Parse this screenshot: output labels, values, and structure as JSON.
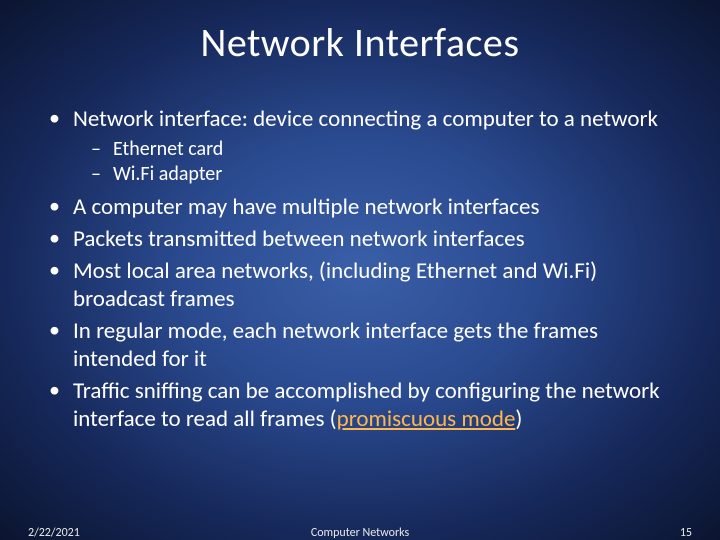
{
  "slide": {
    "title": "Network Interfaces",
    "bullets": {
      "b0": "Network interface: device connecting a computer to a network",
      "b0_sub0": "Ethernet card",
      "b0_sub1": "Wi.Fi adapter",
      "b1": "A computer may have multiple network interfaces",
      "b2": "Packets transmitted between network interfaces",
      "b3": "Most local area networks, (including Ethernet and Wi.Fi) broadcast frames",
      "b4": "In regular mode, each network interface gets the frames intended for it",
      "b5_pre": "Traffic sniffing can be accomplished by configuring the network interface to read all frames (",
      "b5_link": "promiscuous mode",
      "b5_post": ")"
    },
    "footer": {
      "date": "2/22/2021",
      "title": "Computer Networks",
      "page": "15"
    }
  }
}
